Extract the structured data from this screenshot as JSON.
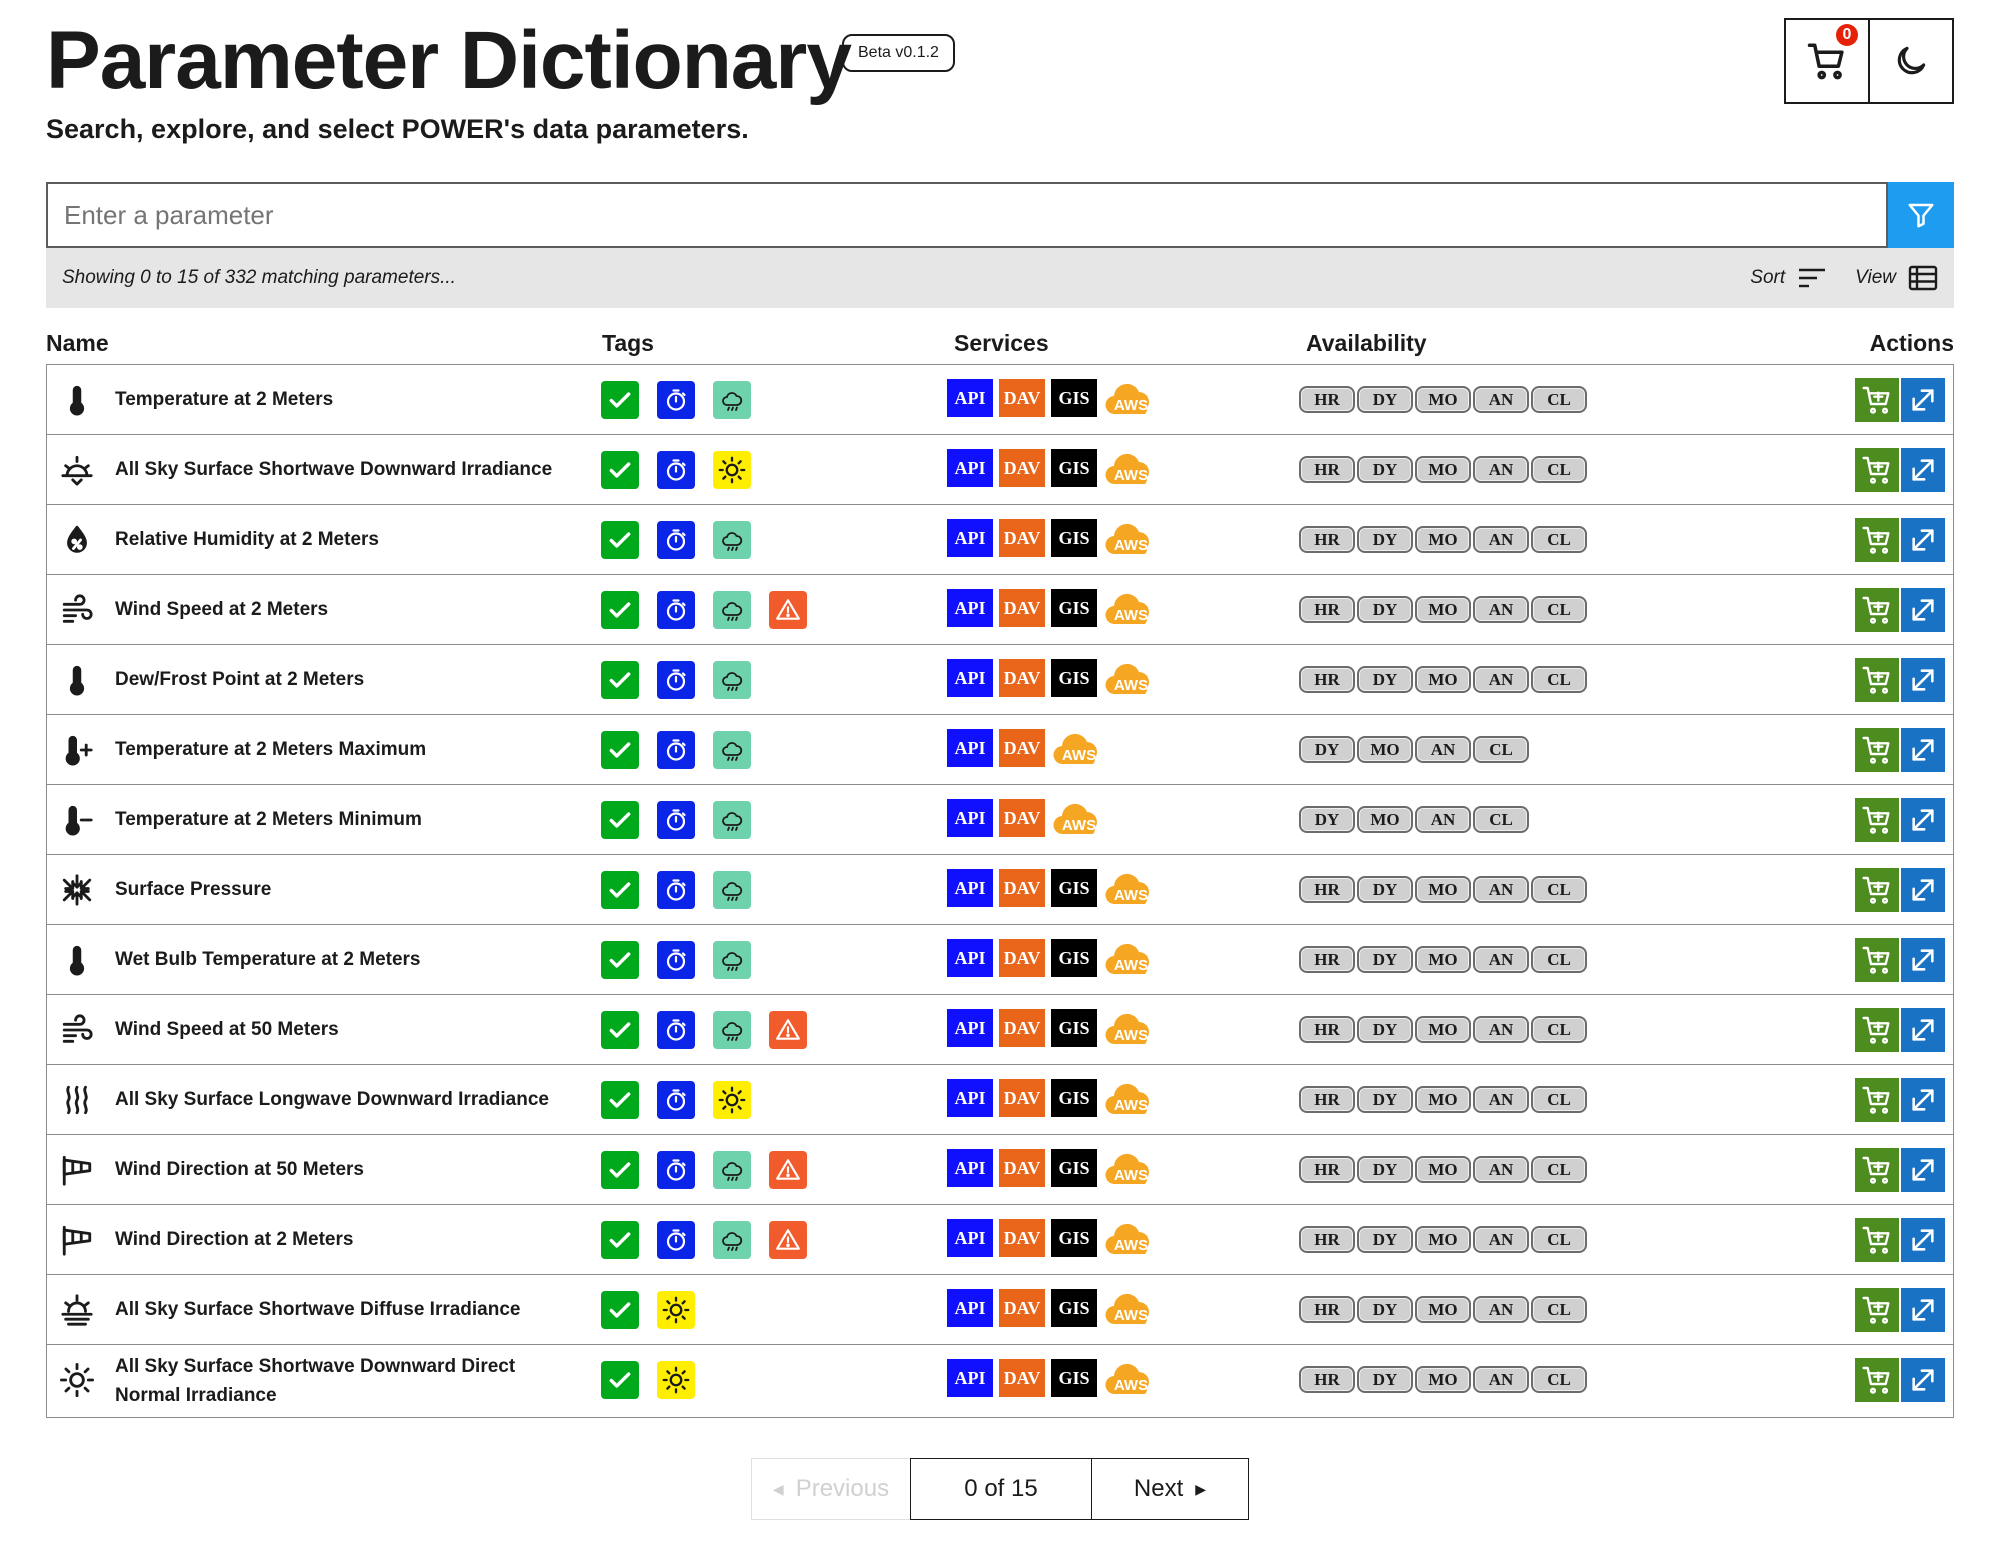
{
  "header": {
    "title": "Parameter Dictionary",
    "beta": "Beta v0.1.2",
    "subtitle": "Search, explore, and select POWER's data parameters.",
    "cart_count": "0"
  },
  "search": {
    "placeholder": "Enter a parameter",
    "status": "Showing 0 to 15 of 332 matching parameters...",
    "sort_label": "Sort",
    "view_label": "View"
  },
  "columns": {
    "name": "Name",
    "tags": "Tags",
    "services": "Services",
    "availability": "Availability",
    "actions": "Actions"
  },
  "service_labels": {
    "api": "API",
    "dav": "DAV",
    "gis": "GIS",
    "aws": "AWS"
  },
  "rows": [
    {
      "name": "Temperature at 2 Meters",
      "icon": "thermometer-icon",
      "tags": [
        "check",
        "temporal",
        "met"
      ],
      "services": [
        "api",
        "dav",
        "gis",
        "aws"
      ],
      "availability": [
        "HR",
        "DY",
        "MO",
        "AN",
        "CL"
      ]
    },
    {
      "name": "All Sky Surface Shortwave Downward Irradiance",
      "icon": "sun-down-icon",
      "tags": [
        "check",
        "temporal",
        "solar"
      ],
      "services": [
        "api",
        "dav",
        "gis",
        "aws"
      ],
      "availability": [
        "HR",
        "DY",
        "MO",
        "AN",
        "CL"
      ]
    },
    {
      "name": "Relative Humidity at 2 Meters",
      "icon": "humidity-drop-icon",
      "tags": [
        "check",
        "temporal",
        "met"
      ],
      "services": [
        "api",
        "dav",
        "gis",
        "aws"
      ],
      "availability": [
        "HR",
        "DY",
        "MO",
        "AN",
        "CL"
      ]
    },
    {
      "name": "Wind Speed at 2 Meters",
      "icon": "wind-icon",
      "tags": [
        "check",
        "temporal",
        "met",
        "warn"
      ],
      "services": [
        "api",
        "dav",
        "gis",
        "aws"
      ],
      "availability": [
        "HR",
        "DY",
        "MO",
        "AN",
        "CL"
      ]
    },
    {
      "name": "Dew/Frost Point at 2 Meters",
      "icon": "thermometer-icon",
      "tags": [
        "check",
        "temporal",
        "met"
      ],
      "services": [
        "api",
        "dav",
        "gis",
        "aws"
      ],
      "availability": [
        "HR",
        "DY",
        "MO",
        "AN",
        "CL"
      ]
    },
    {
      "name": "Temperature at 2 Meters Maximum",
      "icon": "thermometer-plus-icon",
      "tags": [
        "check",
        "temporal",
        "met"
      ],
      "services": [
        "api",
        "dav",
        "aws"
      ],
      "availability": [
        "DY",
        "MO",
        "AN",
        "CL"
      ]
    },
    {
      "name": "Temperature at 2 Meters Minimum",
      "icon": "thermometer-minus-icon",
      "tags": [
        "check",
        "temporal",
        "met"
      ],
      "services": [
        "api",
        "dav",
        "aws"
      ],
      "availability": [
        "DY",
        "MO",
        "AN",
        "CL"
      ]
    },
    {
      "name": "Surface Pressure",
      "icon": "pressure-icon",
      "tags": [
        "check",
        "temporal",
        "met"
      ],
      "services": [
        "api",
        "dav",
        "gis",
        "aws"
      ],
      "availability": [
        "HR",
        "DY",
        "MO",
        "AN",
        "CL"
      ]
    },
    {
      "name": "Wet Bulb Temperature at 2 Meters",
      "icon": "thermometer-icon",
      "tags": [
        "check",
        "temporal",
        "met"
      ],
      "services": [
        "api",
        "dav",
        "gis",
        "aws"
      ],
      "availability": [
        "HR",
        "DY",
        "MO",
        "AN",
        "CL"
      ]
    },
    {
      "name": "Wind Speed at 50 Meters",
      "icon": "wind-icon",
      "tags": [
        "check",
        "temporal",
        "met",
        "warn"
      ],
      "services": [
        "api",
        "dav",
        "gis",
        "aws"
      ],
      "availability": [
        "HR",
        "DY",
        "MO",
        "AN",
        "CL"
      ]
    },
    {
      "name": "All Sky Surface Longwave Downward Irradiance",
      "icon": "heat-waves-icon",
      "tags": [
        "check",
        "temporal",
        "solar"
      ],
      "services": [
        "api",
        "dav",
        "gis",
        "aws"
      ],
      "availability": [
        "HR",
        "DY",
        "MO",
        "AN",
        "CL"
      ]
    },
    {
      "name": "Wind Direction at 50 Meters",
      "icon": "windsock-icon",
      "tags": [
        "check",
        "temporal",
        "met",
        "warn"
      ],
      "services": [
        "api",
        "dav",
        "gis",
        "aws"
      ],
      "availability": [
        "HR",
        "DY",
        "MO",
        "AN",
        "CL"
      ]
    },
    {
      "name": "Wind Direction at 2 Meters",
      "icon": "windsock-icon",
      "tags": [
        "check",
        "temporal",
        "met",
        "warn"
      ],
      "services": [
        "api",
        "dav",
        "gis",
        "aws"
      ],
      "availability": [
        "HR",
        "DY",
        "MO",
        "AN",
        "CL"
      ]
    },
    {
      "name": "All Sky Surface Shortwave Diffuse Irradiance",
      "icon": "sun-haze-icon",
      "tags": [
        "check",
        "solar"
      ],
      "services": [
        "api",
        "dav",
        "gis",
        "aws"
      ],
      "availability": [
        "HR",
        "DY",
        "MO",
        "AN",
        "CL"
      ]
    },
    {
      "name": "All Sky Surface Shortwave Downward Direct Normal Irradiance",
      "icon": "sun-icon",
      "tags": [
        "check",
        "solar"
      ],
      "services": [
        "api",
        "dav",
        "gis",
        "aws"
      ],
      "availability": [
        "HR",
        "DY",
        "MO",
        "AN",
        "CL"
      ]
    }
  ],
  "pagination": {
    "previous": "Previous",
    "info": "0 of 15",
    "next": "Next"
  },
  "colors": {
    "check": "#00a91c",
    "temporal": "#0a25e8",
    "met": "#6ed2ac",
    "solar": "#ffee00",
    "warn": "#f25c2c",
    "api": "#1010ff",
    "dav": "#e8651a",
    "gis": "#000000",
    "add": "#4d8c1e",
    "open": "#1a72c4",
    "filter": "#1e9cf0"
  }
}
